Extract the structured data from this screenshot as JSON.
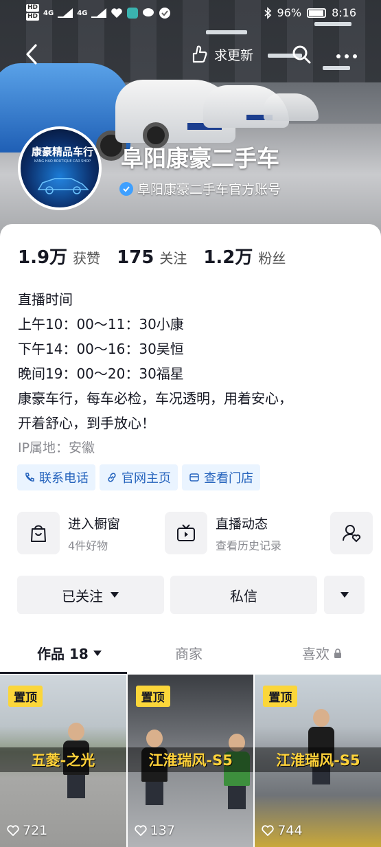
{
  "status_bar": {
    "hd1": "HD",
    "hd2": "HD",
    "net1": "4G",
    "net2": "4G",
    "battery": "96%",
    "time": "8:16"
  },
  "nav": {
    "update_label": "求更新"
  },
  "profile": {
    "avatar_text": "康豪精品车行",
    "avatar_subtext": "KANG HAO BOUTIQUE CAR SHOP",
    "name": "阜阳康豪二手车",
    "verified_label": "阜阳康豪二手车官方账号"
  },
  "stats": [
    {
      "num": "1.9万",
      "label": "获赞"
    },
    {
      "num": "175",
      "label": "关注"
    },
    {
      "num": "1.2万",
      "label": "粉丝"
    }
  ],
  "bio_lines": [
    "直播时间",
    "上午10：00～11：30小康",
    "下午14：00～16：30吴恒",
    "晚间19：00～20：30福星",
    "康豪车行，每车必检，车况透明，用着安心，",
    "开着舒心，到手放心！"
  ],
  "ip": "IP属地：安徽",
  "links": [
    {
      "label": "联系电话",
      "icon": "phone-icon"
    },
    {
      "label": "官网主页",
      "icon": "link-icon"
    },
    {
      "label": "查看门店",
      "icon": "store-icon"
    }
  ],
  "services": {
    "shop_title": "进入橱窗",
    "shop_sub": "4件好物",
    "live_title": "直播动态",
    "live_sub": "查看历史记录"
  },
  "actions": {
    "followed": "已关注",
    "message": "私信"
  },
  "tabs": {
    "works": "作品 18",
    "merchant": "商家",
    "likes": "喜欢"
  },
  "videos": [
    {
      "pin": "置顶",
      "title": "五菱-之光",
      "likes": "721"
    },
    {
      "pin": "置顶",
      "title": "江淮瑞风-S5",
      "likes": "137"
    },
    {
      "pin": "置顶",
      "title": "江淮瑞风-S5",
      "likes": "744"
    }
  ],
  "colors": {
    "link_bg": "#eaf4ff",
    "link_text": "#2563bd",
    "pin_bg": "#fbd63a",
    "verified_blue": "#3fa0ff"
  }
}
